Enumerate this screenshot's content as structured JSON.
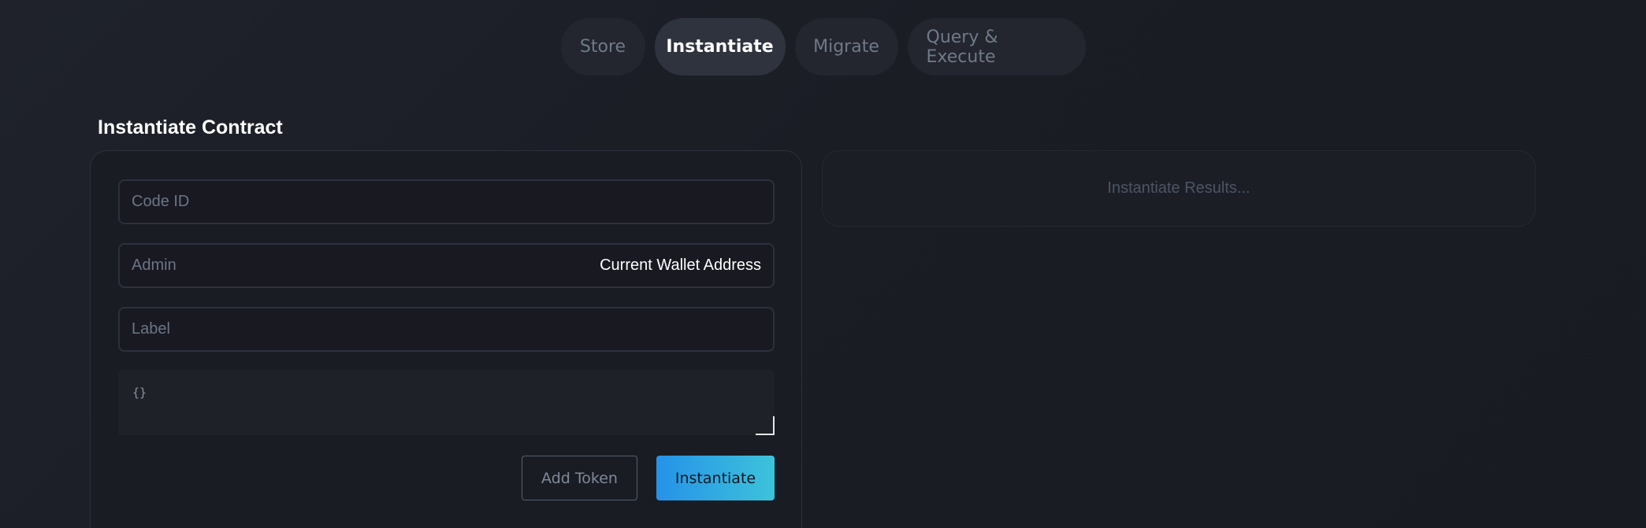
{
  "tabs": [
    {
      "label": "Store",
      "active": false
    },
    {
      "label": "Instantiate",
      "active": true
    },
    {
      "label": "Migrate",
      "active": false
    },
    {
      "label": "Query & Execute",
      "active": false
    }
  ],
  "section": {
    "title": "Instantiate Contract"
  },
  "form": {
    "code_id": {
      "placeholder": "Code ID",
      "value": ""
    },
    "admin": {
      "label": "Admin",
      "value": "Current Wallet Address"
    },
    "label": {
      "placeholder": "Label",
      "value": ""
    },
    "message": {
      "value": "{}"
    },
    "add_token_label": "Add Token",
    "instantiate_label": "Instantiate"
  },
  "results": {
    "placeholder": "Instantiate Results..."
  },
  "colors": {
    "accent_start": "#2592e8",
    "accent_end": "#3dc3da",
    "background": "#1b1d25"
  }
}
